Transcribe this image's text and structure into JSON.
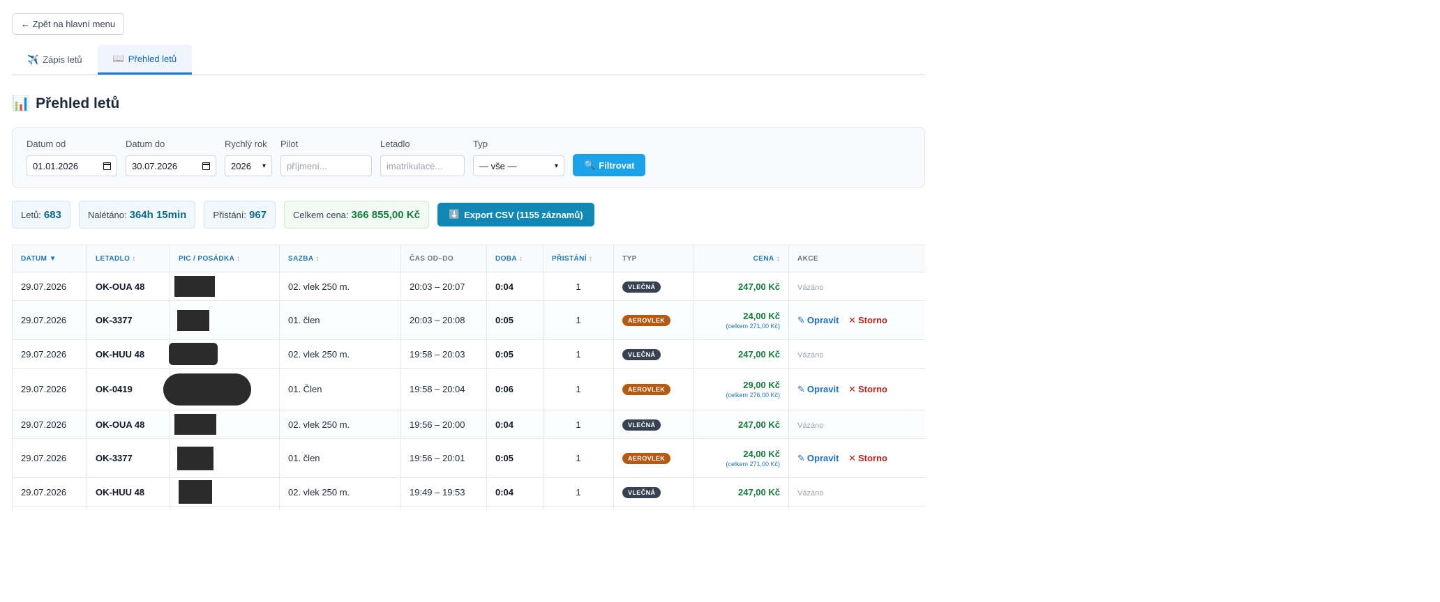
{
  "nav": {
    "back_label": "← Zpět na hlavní menu"
  },
  "tabs": [
    {
      "icon": "✈️",
      "label": "Zápis letů"
    },
    {
      "icon": "📖",
      "label": "Přehled letů"
    }
  ],
  "page": {
    "icon": "📊",
    "title": "Přehled letů"
  },
  "filters": {
    "date_from": {
      "label": "Datum od",
      "value": "01.01.2026"
    },
    "date_to": {
      "label": "Datum do",
      "value": "30.07.2026"
    },
    "quick_year": {
      "label": "Rychlý rok",
      "value": "2026"
    },
    "pilot": {
      "label": "Pilot",
      "placeholder": "příjmení..."
    },
    "aircraft": {
      "label": "Letadlo",
      "placeholder": "imatrikulace..."
    },
    "type": {
      "label": "Typ",
      "value": "— vše —"
    },
    "submit_icon": "🔍",
    "submit_label": "Filtrovat"
  },
  "stats": {
    "flights": {
      "label": "Letů:",
      "value": "683"
    },
    "flown": {
      "label": "Nalétáno:",
      "value": "364h 15min"
    },
    "landings": {
      "label": "Přistání:",
      "value": "967"
    },
    "total": {
      "label": "Celkem cena:",
      "value": "366 855,00 Kč"
    },
    "export_icon": "⬇️",
    "export_label": "Export CSV (1155 záznamů)"
  },
  "table": {
    "headers": {
      "date": "DATUM",
      "date_sort": "▼",
      "aircraft": "LETADLO",
      "pic": "PIC / POSÁDKA",
      "rate": "SAZBA",
      "time": "ČAS OD–DO",
      "duration": "DOBA",
      "landings": "PŘISTÁNÍ",
      "type": "TYP",
      "price": "CENA",
      "actions": "AKCE",
      "sort_glyph": "↕"
    },
    "rows": [
      {
        "date": "29.07.2026",
        "aircraft": "OK-OUA 48",
        "rate": "02. vlek 250 m.",
        "time": "20:03 – 20:07",
        "duration": "0:04",
        "landings": "1",
        "type": "VLEČNÁ",
        "price": "247,00 Kč",
        "status": "Vázáno"
      },
      {
        "date": "29.07.2026",
        "aircraft": "OK-3377",
        "rate": "01. člen",
        "time": "20:03 – 20:08",
        "duration": "0:05",
        "landings": "1",
        "type": "AEROVLEK",
        "price": "24,00 Kč",
        "price_total": "(celkem 271,00 Kč)",
        "edit": "Opravit",
        "cancel": "Storno"
      },
      {
        "date": "29.07.2026",
        "aircraft": "OK-HUU 48",
        "rate": "02. vlek 250 m.",
        "time": "19:58 – 20:03",
        "duration": "0:05",
        "landings": "1",
        "type": "VLEČNÁ",
        "price": "247,00 Kč",
        "status": "Vázáno"
      },
      {
        "date": "29.07.2026",
        "aircraft": "OK-0419",
        "rate": "01. Člen",
        "time": "19:58 – 20:04",
        "duration": "0:06",
        "landings": "1",
        "type": "AEROVLEK",
        "price": "29,00 Kč",
        "price_total": "(celkem 276,00 Kč)",
        "edit": "Opravit",
        "cancel": "Storno"
      },
      {
        "date": "29.07.2026",
        "aircraft": "OK-OUA 48",
        "rate": "02. vlek 250 m.",
        "time": "19:56 – 20:00",
        "duration": "0:04",
        "landings": "1",
        "type": "VLEČNÁ",
        "price": "247,00 Kč",
        "status": "Vázáno"
      },
      {
        "date": "29.07.2026",
        "aircraft": "OK-3377",
        "rate": "01. člen",
        "time": "19:56 – 20:01",
        "duration": "0:05",
        "landings": "1",
        "type": "AEROVLEK",
        "price": "24,00 Kč",
        "price_total": "(celkem 271,00 Kč)",
        "edit": "Opravit",
        "cancel": "Storno"
      },
      {
        "date": "29.07.2026",
        "aircraft": "OK-HUU 48",
        "rate": "02. vlek 250 m.",
        "time": "19:49 – 19:53",
        "duration": "0:04",
        "landings": "1",
        "type": "VLEČNÁ",
        "price": "247,00 Kč",
        "status": "Vázáno"
      }
    ]
  }
}
